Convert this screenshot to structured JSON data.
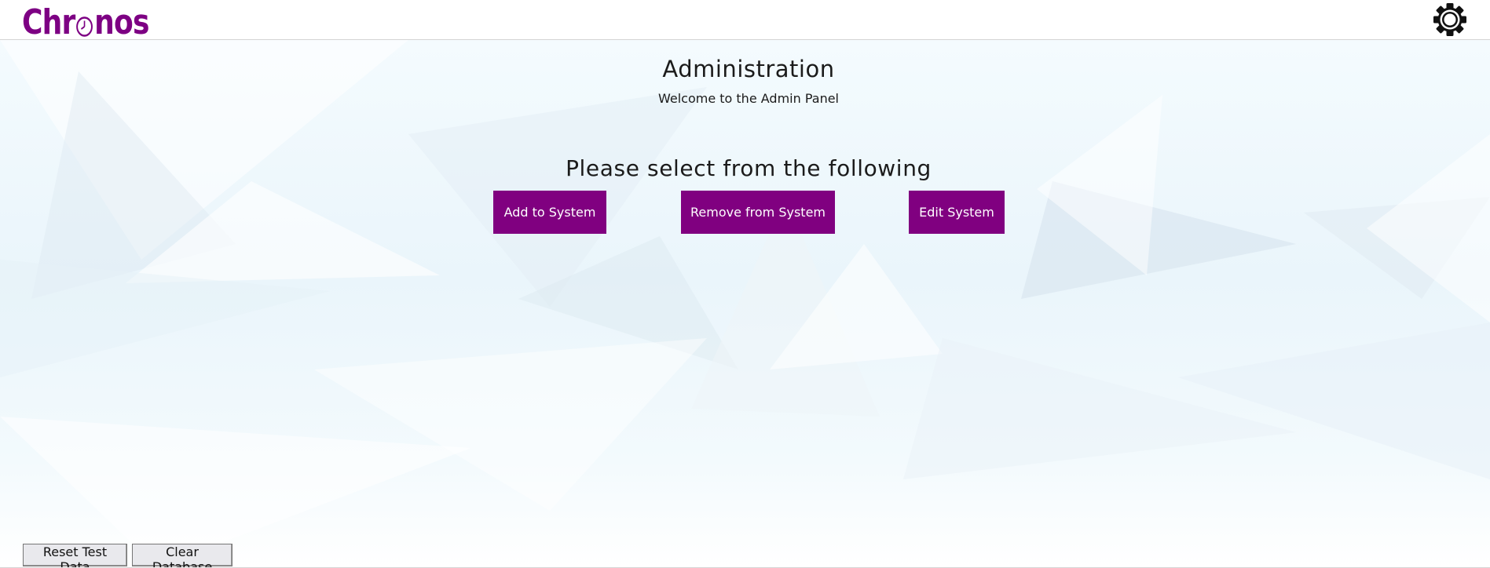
{
  "brand": {
    "logo_prefix": "Chr",
    "logo_suffix": "nos",
    "logo_color": "#7d0083",
    "logo_o_icon": "clock-icon"
  },
  "header": {
    "settings_icon": "gear-icon"
  },
  "page": {
    "title": "Administration",
    "subtitle": "Welcome to the Admin Panel",
    "prompt": "Please select from the following"
  },
  "actions": {
    "add": "Add to System",
    "remove": "Remove from System",
    "edit": "Edit System",
    "button_color": "#800080"
  },
  "footer_buttons": {
    "reset": "Reset Test Data",
    "clear": "Clear Database"
  }
}
